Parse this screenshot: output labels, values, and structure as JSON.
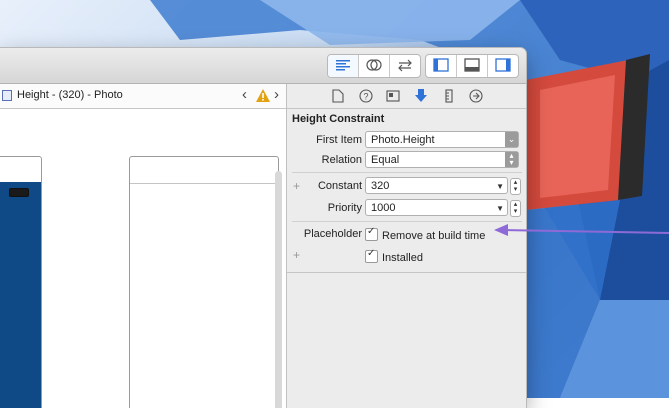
{
  "toolbar": {
    "editor_modes": [
      "standard-editor-icon",
      "assistant-editor-icon",
      "version-editor-icon"
    ],
    "panels": [
      "navigator-panel-icon",
      "debug-panel-icon",
      "utilities-panel-icon"
    ]
  },
  "jumpbar": {
    "title": "Height - (320) - Photo"
  },
  "inspector": {
    "tabs": [
      "file-icon",
      "help-icon",
      "identity-icon",
      "attributes-icon",
      "size-icon",
      "connections-icon"
    ],
    "section_title": "Height Constraint",
    "first_item": {
      "label": "First Item",
      "value": "Photo.Height"
    },
    "relation": {
      "label": "Relation",
      "value": "Equal"
    },
    "constant": {
      "label": "Constant",
      "value": "320"
    },
    "priority": {
      "label": "Priority",
      "value": "1000"
    },
    "placeholder": {
      "label": "Placeholder",
      "checkbox_label": "Remove at build time",
      "checked": true
    },
    "installed": {
      "checkbox_label": "Installed",
      "checked": true
    }
  },
  "colors": {
    "accent": "#2f73d8",
    "arrow": "#8e6ad7",
    "device_blue": "#0f4a86"
  }
}
